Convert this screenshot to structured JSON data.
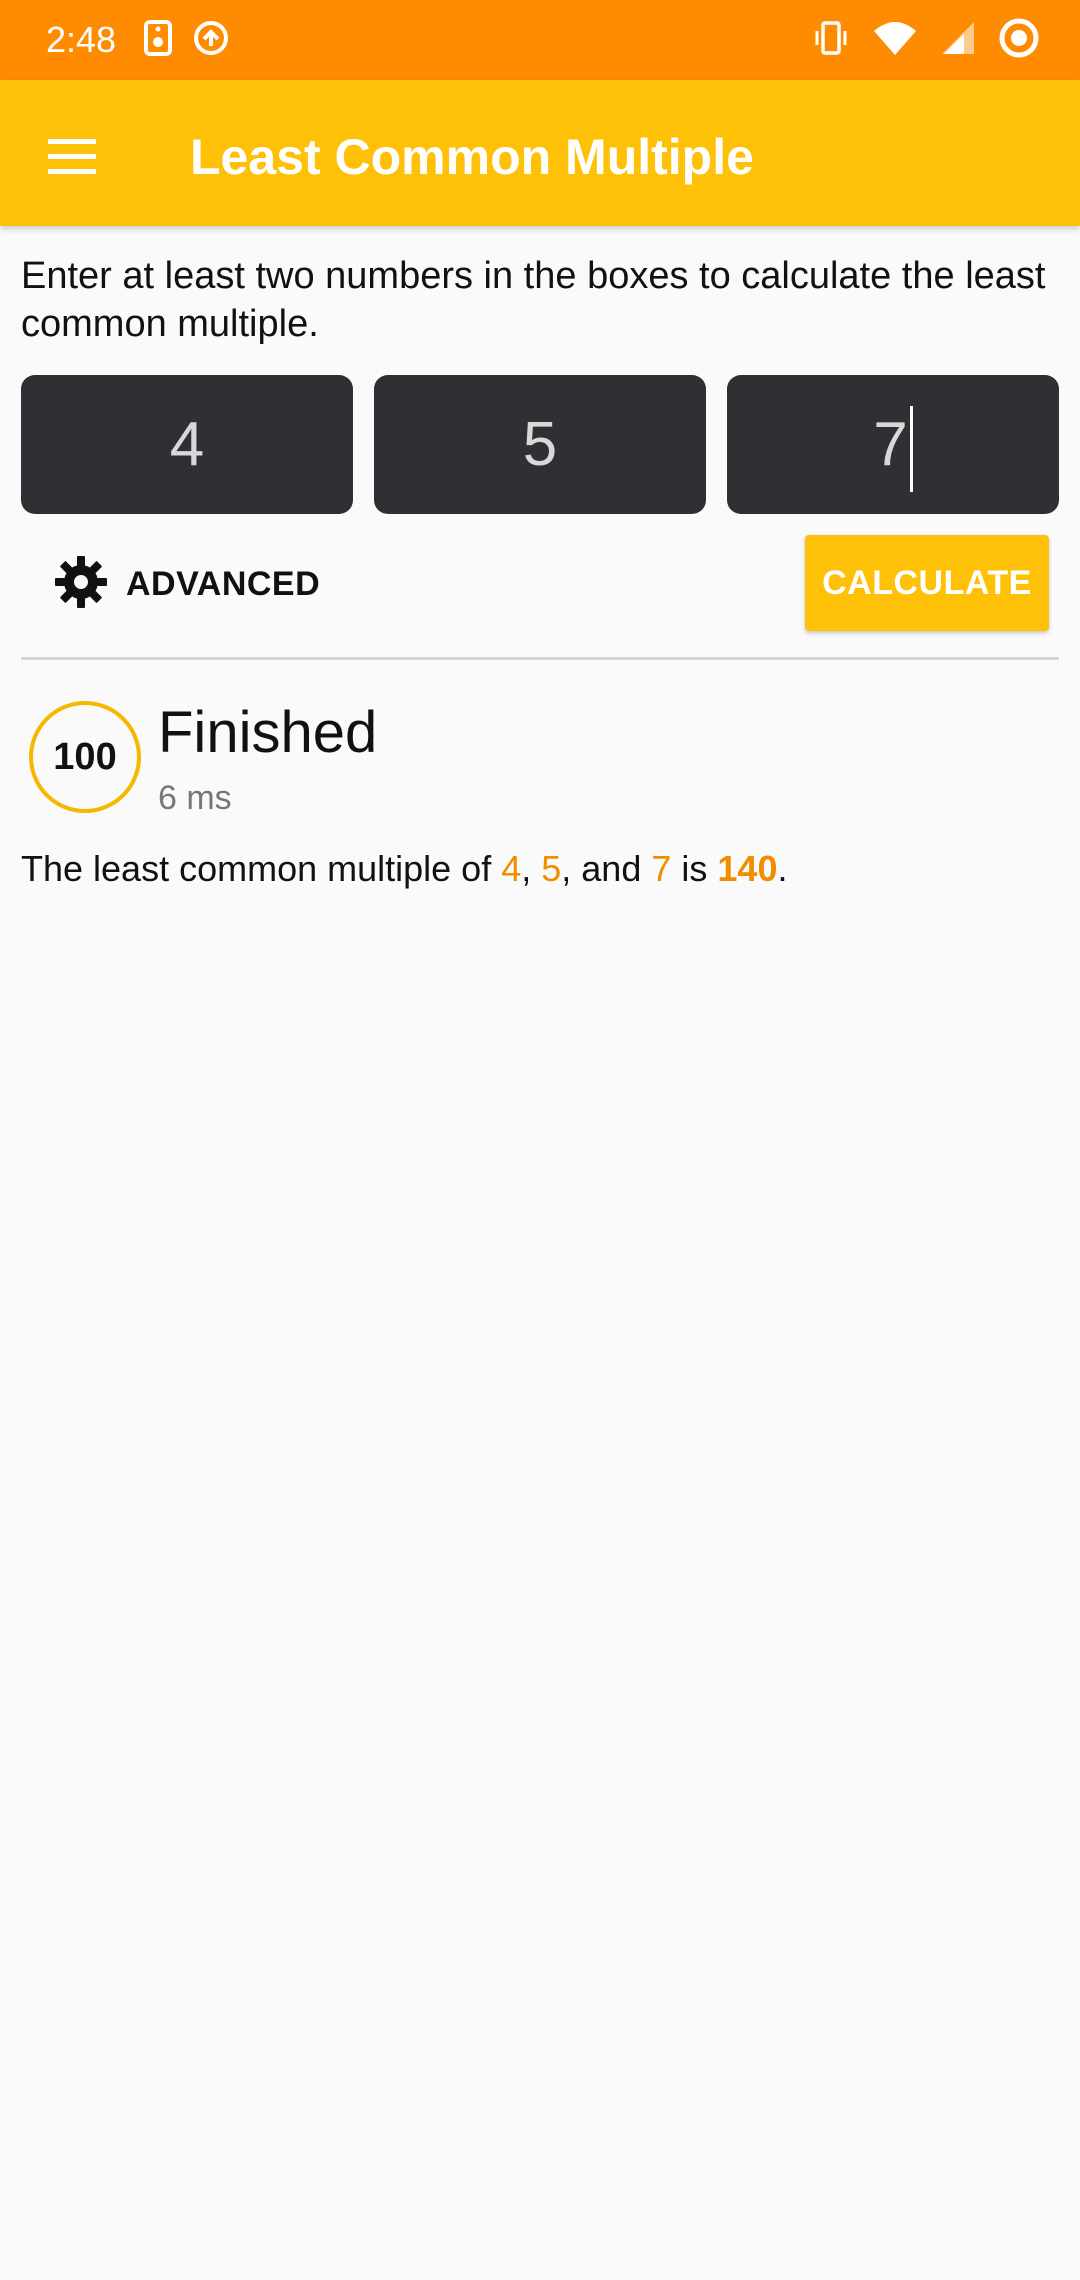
{
  "status_bar": {
    "time": "2:48",
    "left_icons": [
      "speaker-icon",
      "sync-icon"
    ],
    "right_icons": [
      "vibrate-icon",
      "wifi-icon",
      "signal-icon",
      "ring-icon"
    ]
  },
  "app_bar": {
    "title": "Least Common Multiple",
    "menu_icon": "hamburger-menu-icon"
  },
  "main": {
    "instructions": "Enter at least two numbers in the boxes to calculate the least common multiple.",
    "inputs": [
      "4",
      "5",
      "7"
    ],
    "advanced_label": "ADVANCED",
    "calculate_label": "CALCULATE"
  },
  "result": {
    "progress": "100",
    "status": "Finished",
    "time": "6 ms",
    "prefix": "The least common multiple of ",
    "num1": "4",
    "sep1": ", ",
    "num2": "5",
    "sep2": ", and ",
    "num3": "7",
    "middle": " is ",
    "answer": "140",
    "suffix": "."
  },
  "colors": {
    "status_bar": "#ff8c00",
    "app_bar": "#ffc107",
    "accent": "#f28c00",
    "input_bg": "#2f3033"
  }
}
